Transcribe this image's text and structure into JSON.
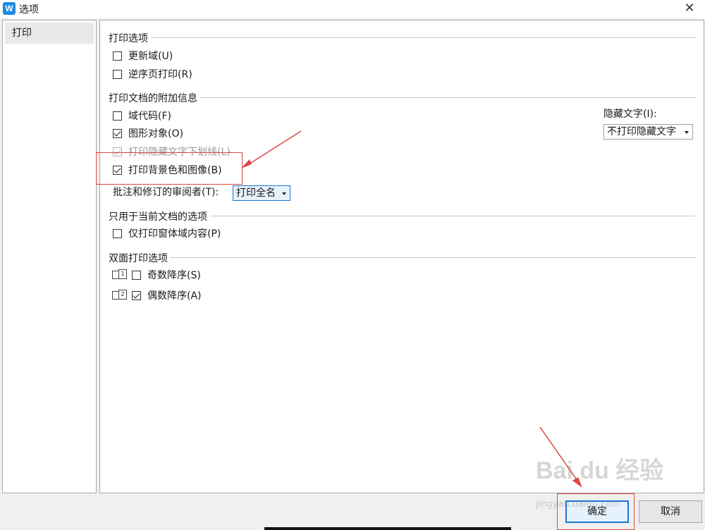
{
  "window": {
    "title": "选项",
    "app_icon_letter": "W",
    "close_glyph": "✕"
  },
  "sidebar": {
    "items": [
      {
        "label": "打印"
      }
    ]
  },
  "sections": {
    "print_options": {
      "title": "打印选项",
      "items": [
        {
          "label": "更新域(U)",
          "checked": false
        },
        {
          "label": "逆序页打印(R)",
          "checked": false
        }
      ]
    },
    "additional_info": {
      "title": "打印文档的附加信息",
      "items": [
        {
          "label": "域代码(F)",
          "checked": false
        },
        {
          "label": "图形对象(O)",
          "checked": true
        },
        {
          "label": "打印隐藏文字下划线(L)",
          "checked": true,
          "disabled": true
        },
        {
          "label": "打印背景色和图像(B)",
          "checked": true
        }
      ],
      "hidden_text_label": "隐藏文字(I):",
      "hidden_text_value": "不打印隐藏文字",
      "reviewer_label": "批注和修订的审阅者(T):",
      "reviewer_value": "打印全名"
    },
    "current_doc": {
      "title": "只用于当前文档的选项",
      "items": [
        {
          "label": "仅打印窗体域内容(P)",
          "checked": false
        }
      ]
    },
    "duplex": {
      "title": "双面打印选项",
      "items": [
        {
          "label": "奇数降序(S)",
          "checked": false,
          "icon_text": "1"
        },
        {
          "label": "偶数降序(A)",
          "checked": true,
          "icon_text": "2"
        }
      ]
    }
  },
  "buttons": {
    "ok": "确定",
    "cancel": "取消"
  },
  "watermark": {
    "main": "Bai du 经验",
    "sub": "jingyan.baidu.com"
  },
  "colors": {
    "annotation": "#e04444",
    "focus": "#1a76d2"
  }
}
